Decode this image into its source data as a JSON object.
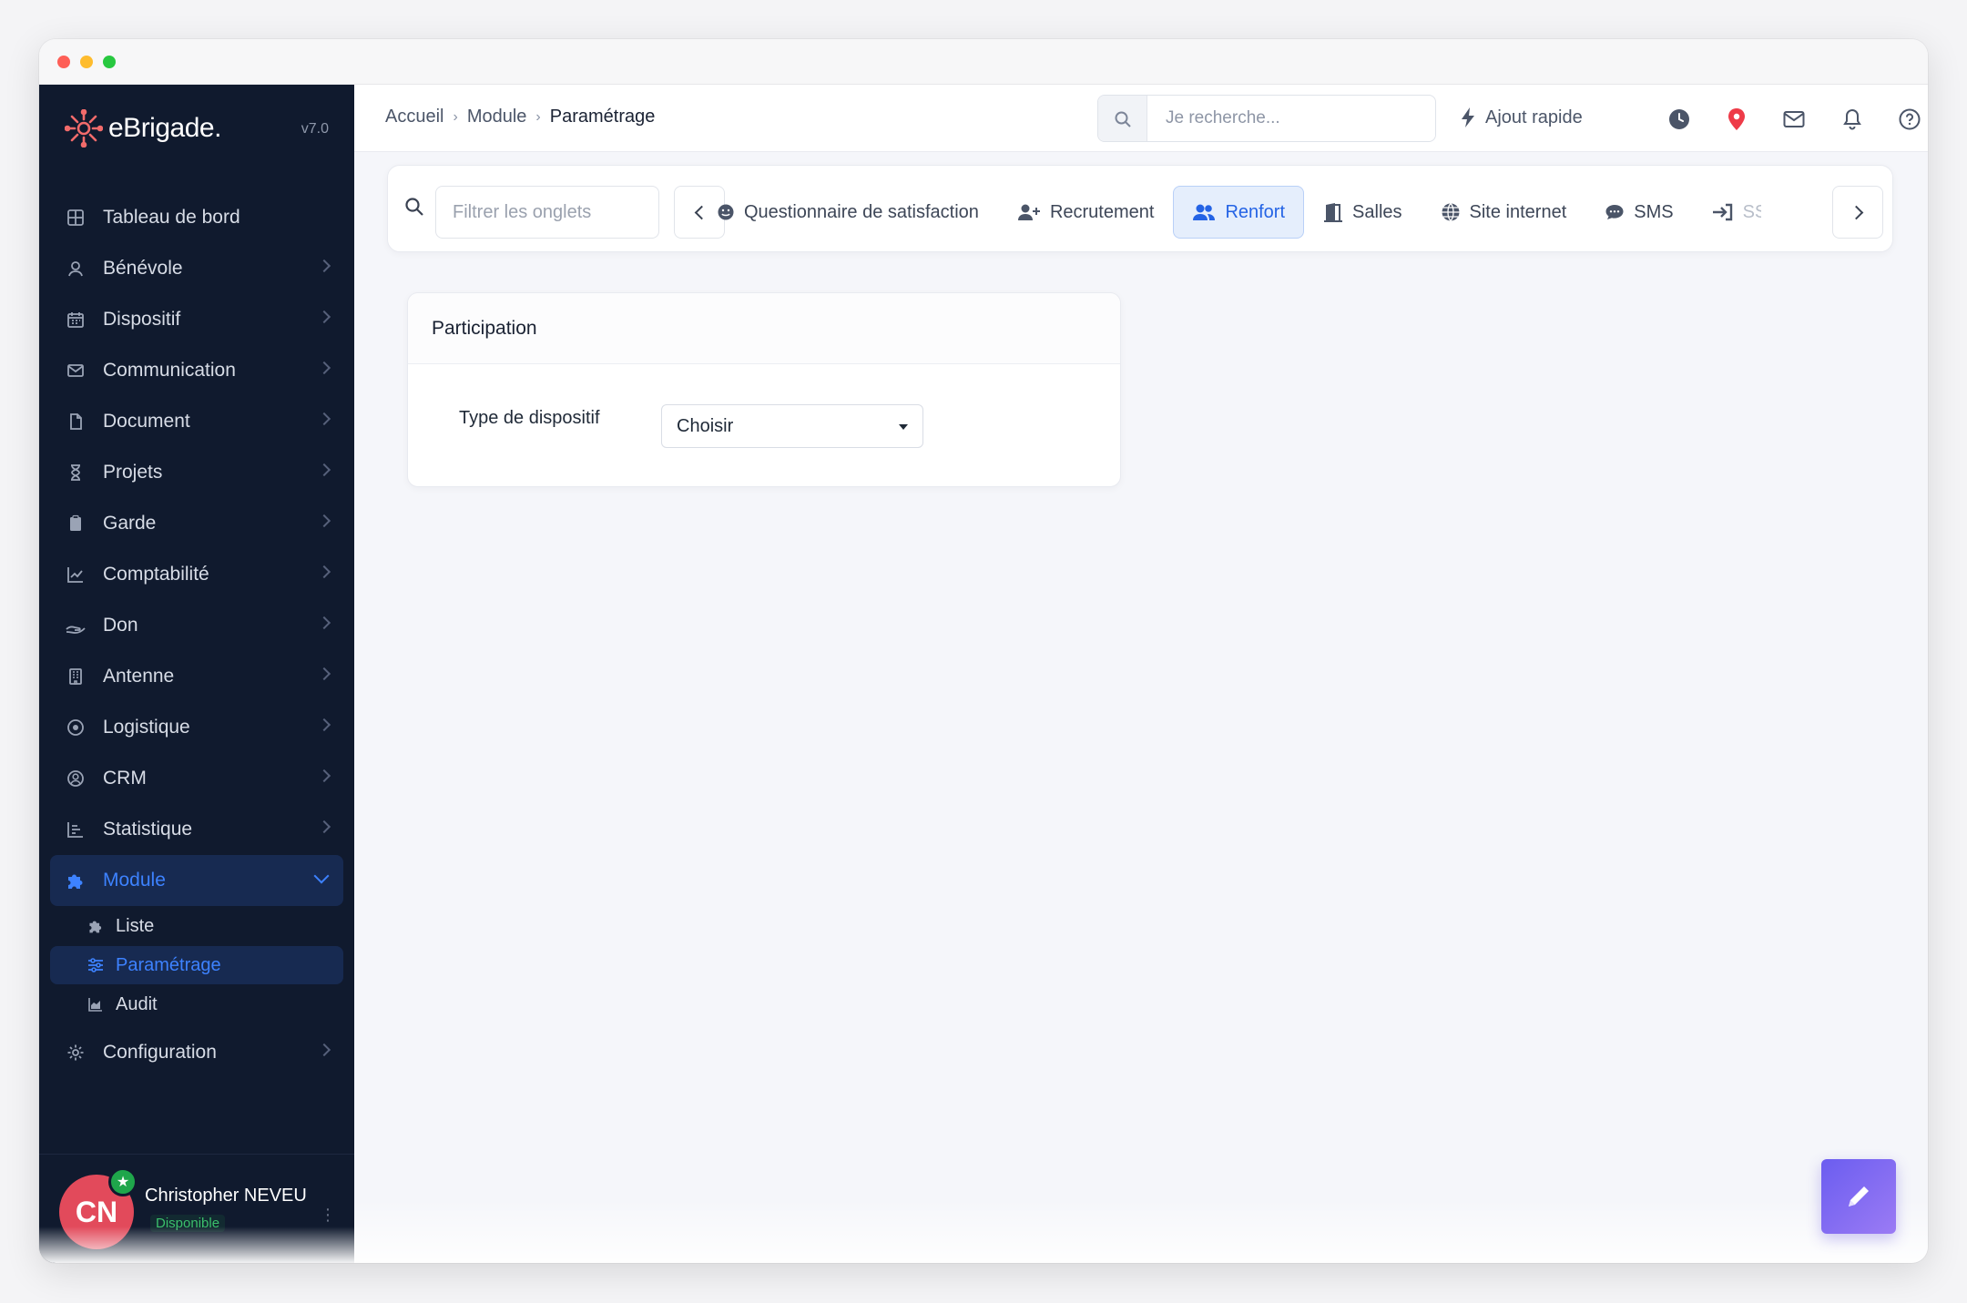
{
  "app": {
    "brand": "eBrigade.",
    "version": "v7.0"
  },
  "sidebar": {
    "items": [
      {
        "label": "Tableau de bord",
        "icon": "dashboard-icon"
      },
      {
        "label": "Bénévole",
        "icon": "user-icon"
      },
      {
        "label": "Dispositif",
        "icon": "calendar-icon"
      },
      {
        "label": "Communication",
        "icon": "mail-icon"
      },
      {
        "label": "Document",
        "icon": "document-icon"
      },
      {
        "label": "Projets",
        "icon": "hourglass-icon"
      },
      {
        "label": "Garde",
        "icon": "clipboard-icon"
      },
      {
        "label": "Comptabilité",
        "icon": "chart-line-icon"
      },
      {
        "label": "Don",
        "icon": "hand-icon"
      },
      {
        "label": "Antenne",
        "icon": "building-icon"
      },
      {
        "label": "Logistique",
        "icon": "circle-dot-icon"
      },
      {
        "label": "CRM",
        "icon": "user-circle-icon"
      },
      {
        "label": "Statistique",
        "icon": "bar-chart-icon"
      }
    ],
    "module": {
      "label": "Module",
      "subitems": [
        {
          "label": "Liste"
        },
        {
          "label": "Paramétrage"
        },
        {
          "label": "Audit"
        }
      ]
    },
    "configuration": "Configuration",
    "user": {
      "initials": "CN",
      "name": "Christopher NEVEU",
      "status": "Disponible",
      "status_color": "#1fa64b"
    }
  },
  "header": {
    "breadcrumb": [
      "Accueil",
      "Module",
      "Paramétrage"
    ],
    "search_placeholder": "Je recherche...",
    "quick_add": "Ajout rapide"
  },
  "tabs": {
    "filter_placeholder": "Filtrer les onglets",
    "items": [
      {
        "label": "Questionnaire de satisfaction",
        "icon": "smile-icon"
      },
      {
        "label": "Recrutement",
        "icon": "user-plus-icon"
      },
      {
        "label": "Renfort",
        "icon": "users-icon",
        "active": true
      },
      {
        "label": "Salles",
        "icon": "door-icon"
      },
      {
        "label": "Site internet",
        "icon": "globe-icon"
      },
      {
        "label": "SMS",
        "icon": "chat-icon"
      },
      {
        "label": "SSO",
        "icon": "sign-in-icon"
      }
    ]
  },
  "panel": {
    "title": "Participation",
    "field_label": "Type de dispositif",
    "select_value": "Choisir"
  },
  "colors": {
    "accent": "#2463e5",
    "sidebar_bg": "#101a2e",
    "brand_logo": "#f26b6b",
    "fab": "#7b6cf2"
  }
}
